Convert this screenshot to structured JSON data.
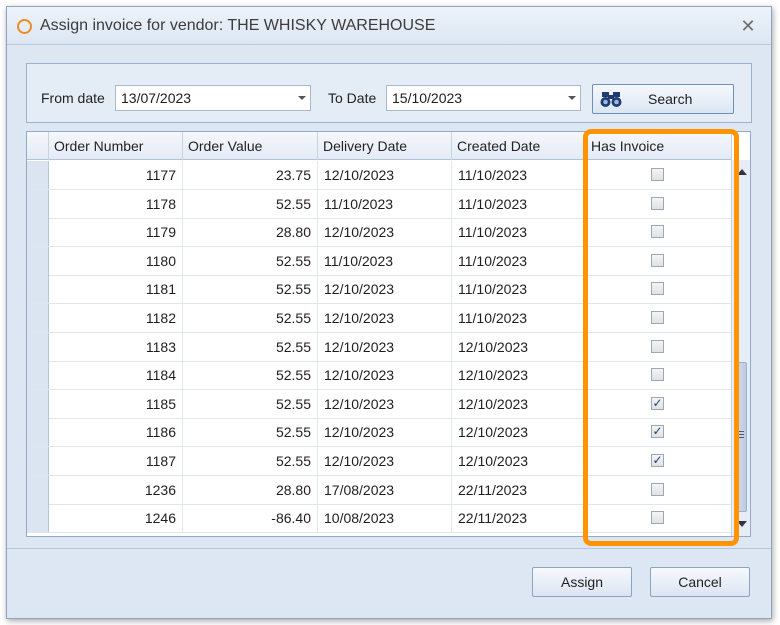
{
  "window": {
    "title": "Assign invoice for vendor: THE WHISKY WAREHOUSE",
    "close_glyph": "✕"
  },
  "filters": {
    "from_label": "From date",
    "from_value": "13/07/2023",
    "to_label": "To Date",
    "to_value": "15/10/2023",
    "search_label": "Search"
  },
  "grid": {
    "columns": [
      "Order Number",
      "Order Value",
      "Delivery Date",
      "Created Date",
      "Has Invoice"
    ],
    "rows": [
      {
        "order_number": "1177",
        "order_value": "23.75",
        "delivery_date": "12/10/2023",
        "created_date": "11/10/2023",
        "has_invoice": false
      },
      {
        "order_number": "1178",
        "order_value": "52.55",
        "delivery_date": "11/10/2023",
        "created_date": "11/10/2023",
        "has_invoice": false
      },
      {
        "order_number": "1179",
        "order_value": "28.80",
        "delivery_date": "12/10/2023",
        "created_date": "11/10/2023",
        "has_invoice": false
      },
      {
        "order_number": "1180",
        "order_value": "52.55",
        "delivery_date": "11/10/2023",
        "created_date": "11/10/2023",
        "has_invoice": false
      },
      {
        "order_number": "1181",
        "order_value": "52.55",
        "delivery_date": "12/10/2023",
        "created_date": "11/10/2023",
        "has_invoice": false
      },
      {
        "order_number": "1182",
        "order_value": "52.55",
        "delivery_date": "12/10/2023",
        "created_date": "11/10/2023",
        "has_invoice": false
      },
      {
        "order_number": "1183",
        "order_value": "52.55",
        "delivery_date": "12/10/2023",
        "created_date": "12/10/2023",
        "has_invoice": false
      },
      {
        "order_number": "1184",
        "order_value": "52.55",
        "delivery_date": "12/10/2023",
        "created_date": "12/10/2023",
        "has_invoice": false
      },
      {
        "order_number": "1185",
        "order_value": "52.55",
        "delivery_date": "12/10/2023",
        "created_date": "12/10/2023",
        "has_invoice": true
      },
      {
        "order_number": "1186",
        "order_value": "52.55",
        "delivery_date": "12/10/2023",
        "created_date": "12/10/2023",
        "has_invoice": true
      },
      {
        "order_number": "1187",
        "order_value": "52.55",
        "delivery_date": "12/10/2023",
        "created_date": "12/10/2023",
        "has_invoice": true
      },
      {
        "order_number": "1236",
        "order_value": "28.80",
        "delivery_date": "17/08/2023",
        "created_date": "22/11/2023",
        "has_invoice": false
      },
      {
        "order_number": "1246",
        "order_value": "-86.40",
        "delivery_date": "10/08/2023",
        "created_date": "22/11/2023",
        "has_invoice": false
      }
    ]
  },
  "buttons": {
    "assign": "Assign",
    "cancel": "Cancel"
  },
  "colors": {
    "highlight": "#ff9400",
    "title_icon": "#f08a24"
  },
  "icons": {
    "title": "app-ring-icon",
    "search": "binoculars-icon",
    "close": "close-icon"
  }
}
